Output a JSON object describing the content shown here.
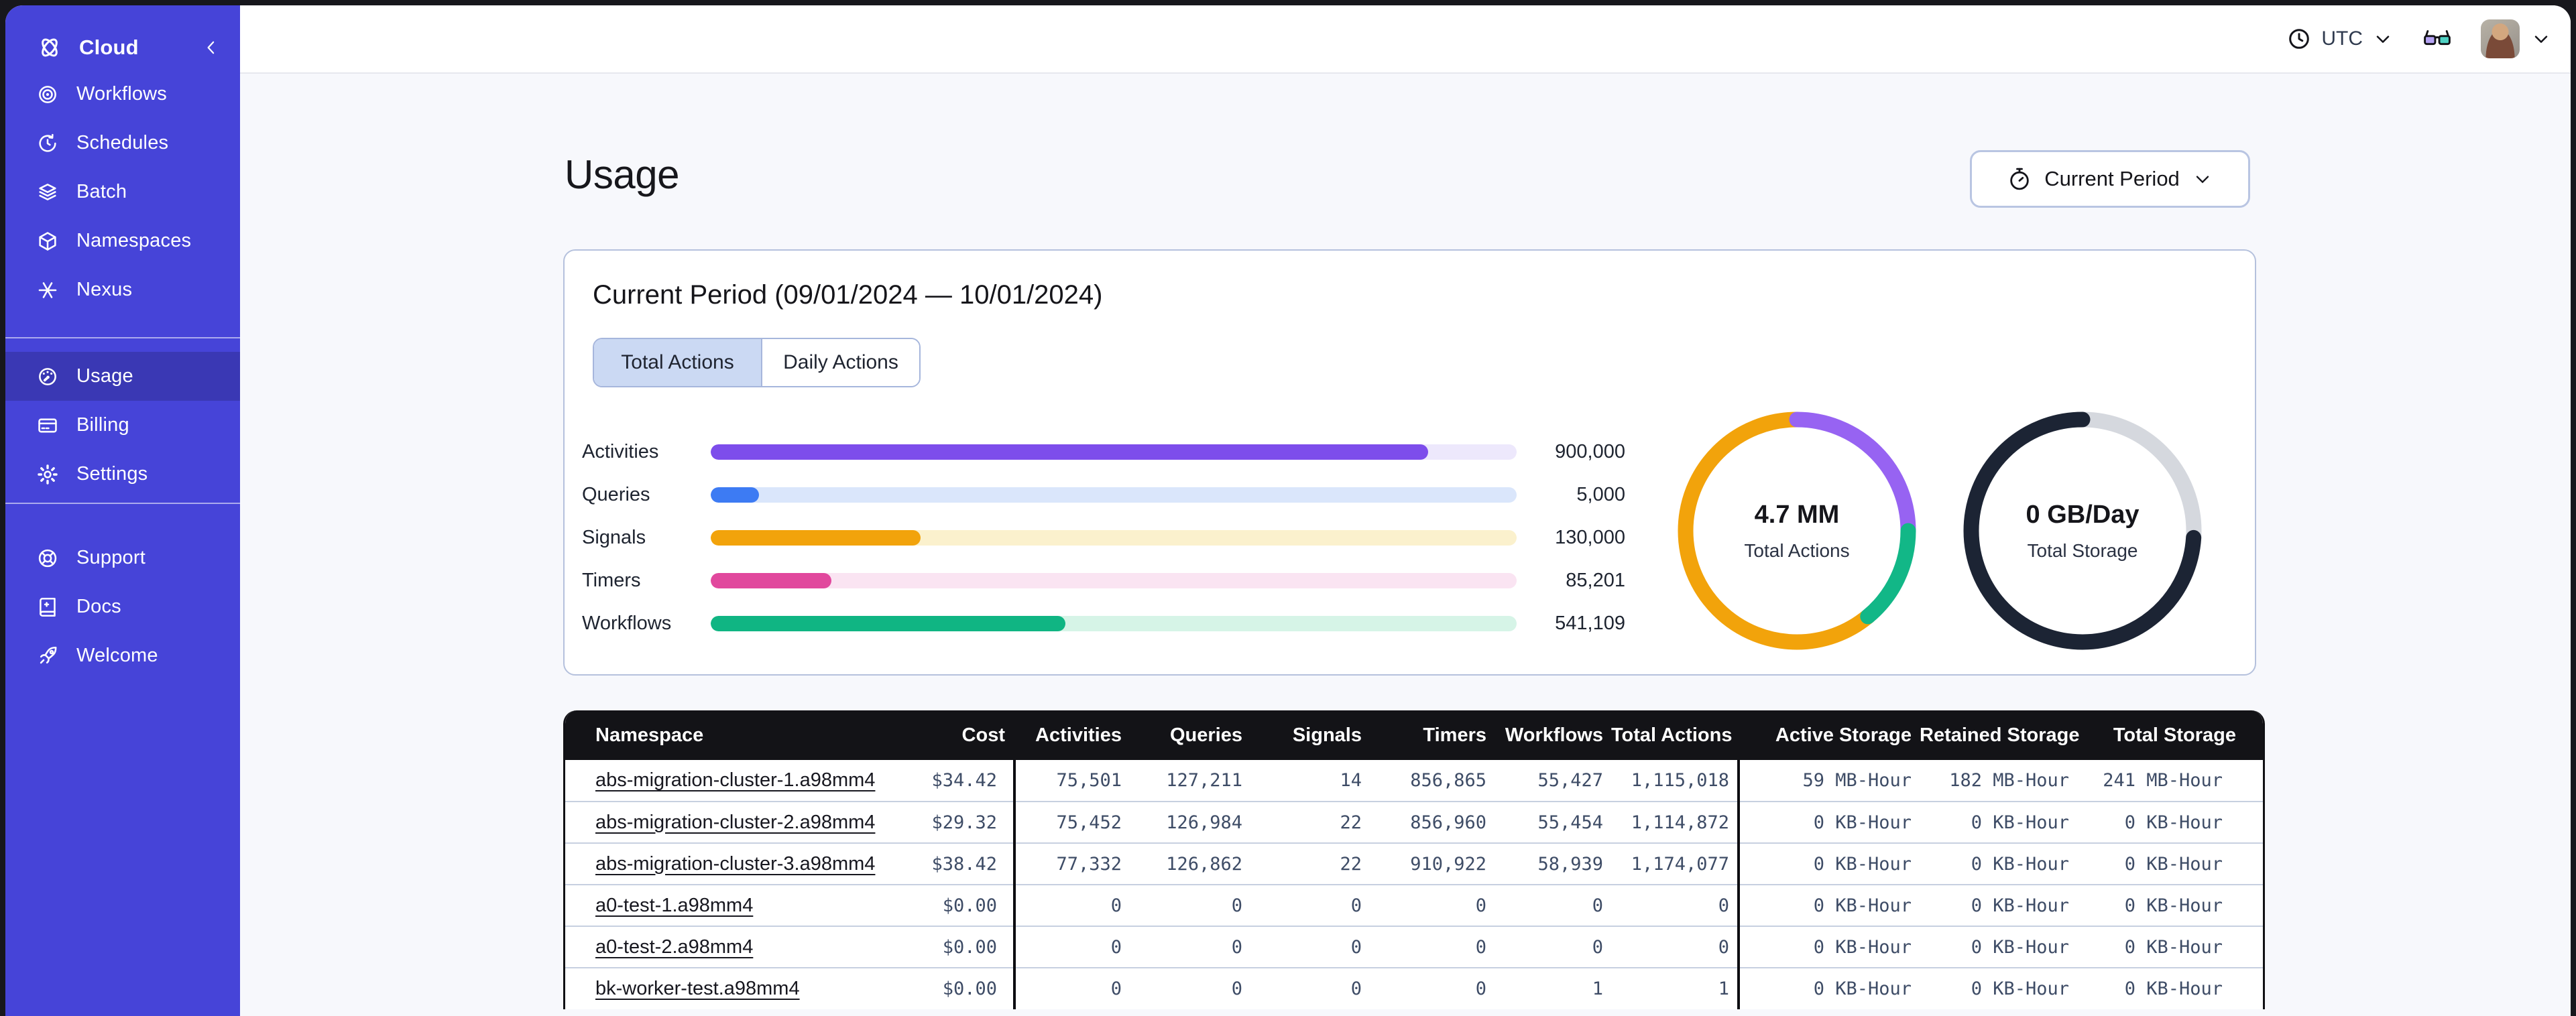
{
  "page": {
    "title": "Usage"
  },
  "topbar": {
    "timezone": "UTC",
    "icons": [
      "clock-icon",
      "chevron-down-icon",
      "glasses-icon",
      "avatar",
      "chevron-down-icon"
    ]
  },
  "sidebar": {
    "brand_label": "Cloud",
    "items": [
      {
        "label": "Workflows",
        "icon": "workflows-icon"
      },
      {
        "label": "Schedules",
        "icon": "schedules-icon"
      },
      {
        "label": "Batch",
        "icon": "batch-icon"
      },
      {
        "label": "Namespaces",
        "icon": "namespaces-icon"
      },
      {
        "label": "Nexus",
        "icon": "nexus-icon"
      },
      {
        "label": "Usage",
        "icon": "usage-icon",
        "active": true
      },
      {
        "label": "Billing",
        "icon": "billing-icon"
      },
      {
        "label": "Settings",
        "icon": "settings-icon"
      },
      {
        "label": "Support",
        "icon": "support-icon"
      },
      {
        "label": "Docs",
        "icon": "docs-icon"
      },
      {
        "label": "Welcome",
        "icon": "welcome-icon"
      }
    ]
  },
  "period_selector": {
    "label": "Current Period"
  },
  "card": {
    "heading": "Current Period (09/01/2024 — 10/01/2024)",
    "tabs": [
      {
        "label": "Total Actions",
        "selected": true
      },
      {
        "label": "Daily Actions",
        "selected": false
      }
    ]
  },
  "chart_data": [
    {
      "type": "bar",
      "categories": [
        "Activities",
        "Queries",
        "Signals",
        "Timers",
        "Workflows"
      ],
      "values": [
        900000,
        5000,
        130000,
        85201,
        541109
      ],
      "display_values": [
        "900,000",
        "5,000",
        "130,000",
        "85,201",
        "541,109"
      ],
      "fill_pct": [
        89,
        6,
        26,
        15,
        44
      ],
      "colors": [
        "#7D4DEB",
        "#3D7BF3",
        "#F2A30B",
        "#E1489D",
        "#10B583"
      ],
      "track_colors": [
        "#EDE8FC",
        "#DAE6FB",
        "#FBF1CD",
        "#FAE4F2",
        "#D6F4E7"
      ]
    },
    {
      "type": "donut",
      "center_value": "4.7 MM",
      "center_label": "Total Actions",
      "segments": [
        {
          "color": "#F2A30B",
          "start": 39,
          "pct": 61
        },
        {
          "color": "#9763F2",
          "start": 0,
          "pct": 25
        },
        {
          "color": "#12B787",
          "start": 25,
          "pct": 14
        }
      ]
    },
    {
      "type": "donut",
      "center_value": "0 GB/Day",
      "center_label": "Total Storage",
      "segments": [
        {
          "color": "#D5D8DE",
          "start": 0,
          "pct": 26
        },
        {
          "color": "#1C2434",
          "start": 26,
          "pct": 74
        }
      ]
    }
  ],
  "table": {
    "columns": [
      "Namespace",
      "Cost",
      "Activities",
      "Queries",
      "Signals",
      "Timers",
      "Workflows",
      "Total Actions",
      "Active Storage",
      "Retained Storage",
      "Total Storage"
    ],
    "rows": [
      [
        "abs-migration-cluster-1.a98mm4",
        "$34.42",
        "75,501",
        "127,211",
        "14",
        "856,865",
        "55,427",
        "1,115,018",
        "59 MB-Hour",
        "182 MB-Hour",
        "241 MB-Hour"
      ],
      [
        "abs-migration-cluster-2.a98mm4",
        "$29.32",
        "75,452",
        "126,984",
        "22",
        "856,960",
        "55,454",
        "1,114,872",
        "0 KB-Hour",
        "0 KB-Hour",
        "0 KB-Hour"
      ],
      [
        "abs-migration-cluster-3.a98mm4",
        "$38.42",
        "77,332",
        "126,862",
        "22",
        "910,922",
        "58,939",
        "1,174,077",
        "0 KB-Hour",
        "0 KB-Hour",
        "0 KB-Hour"
      ],
      [
        "a0-test-1.a98mm4",
        "$0.00",
        "0",
        "0",
        "0",
        "0",
        "0",
        "0",
        "0 KB-Hour",
        "0 KB-Hour",
        "0 KB-Hour"
      ],
      [
        "a0-test-2.a98mm4",
        "$0.00",
        "0",
        "0",
        "0",
        "0",
        "0",
        "0",
        "0 KB-Hour",
        "0 KB-Hour",
        "0 KB-Hour"
      ],
      [
        "bk-worker-test.a98mm4",
        "$0.00",
        "0",
        "0",
        "0",
        "0",
        "1",
        "1",
        "0 KB-Hour",
        "0 KB-Hour",
        "0 KB-Hour"
      ]
    ]
  }
}
